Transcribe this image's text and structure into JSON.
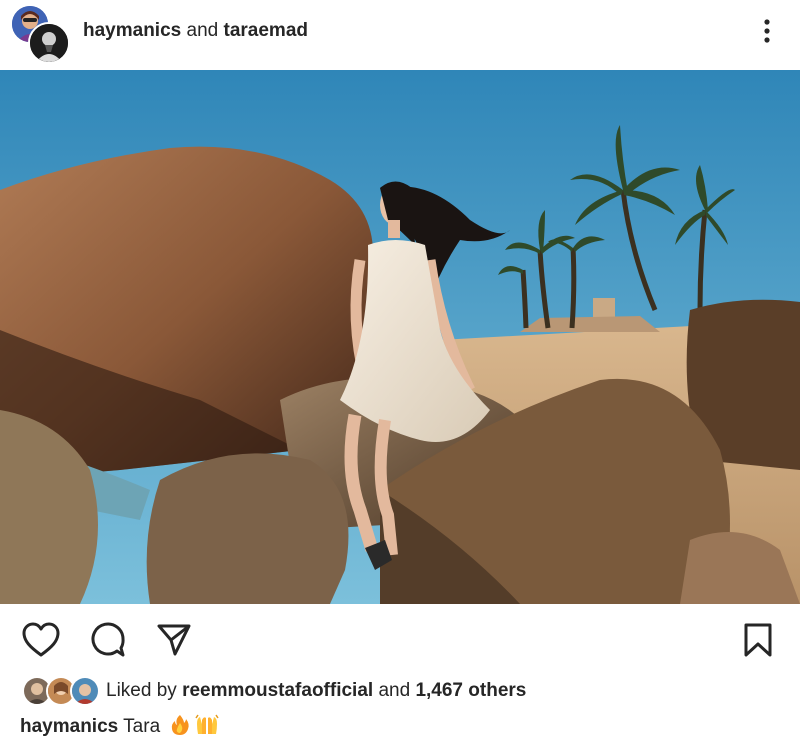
{
  "post_header": {
    "user1": "haymanics",
    "conjunction": "and",
    "user2": "taraemad",
    "more_icon": "more-vertical-icon"
  },
  "photo": {
    "subject": "woman in white dress sitting on rocks near palm trees and the sea"
  },
  "actions": {
    "like_icon": "heart-icon",
    "comment_icon": "comment-icon",
    "share_icon": "send-icon",
    "save_icon": "bookmark-icon"
  },
  "likes": {
    "prefix": "Liked by",
    "user": "reemmoustafaofficial",
    "joiner": "and",
    "count": "1,467 others"
  },
  "caption": {
    "user": "haymanics",
    "text": "Tara",
    "emojis": [
      "fire-emoji",
      "raised-hands-emoji"
    ]
  },
  "colors": {
    "text": "#262626",
    "sky": "#4f9fc4"
  }
}
